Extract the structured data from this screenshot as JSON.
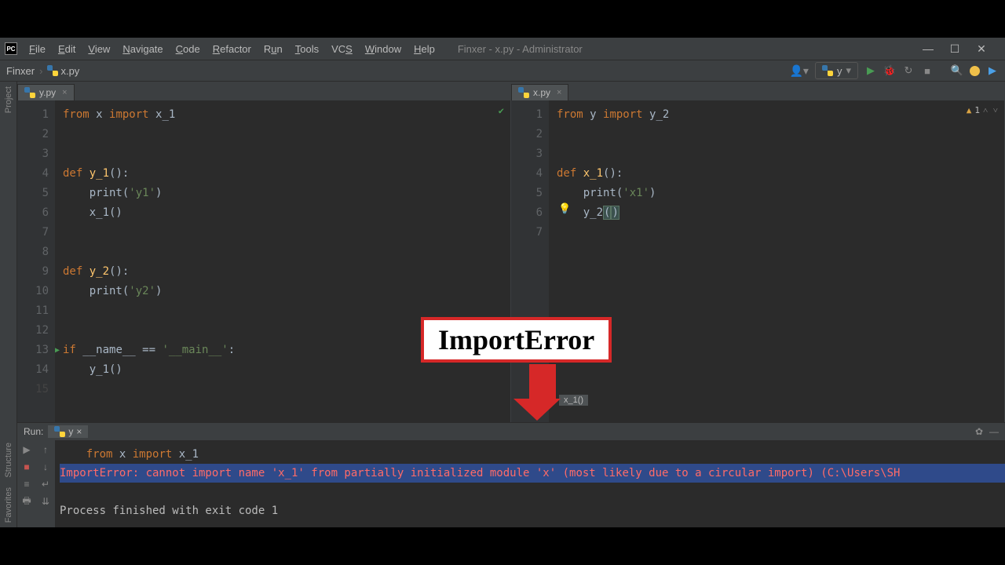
{
  "window": {
    "title": "Finxer - x.py - Administrator"
  },
  "menu": {
    "file": "File",
    "edit": "Edit",
    "view": "View",
    "navigate": "Navigate",
    "code": "Code",
    "refactor": "Refactor",
    "run": "Run",
    "tools": "Tools",
    "vcs": "VCS",
    "window": "Window",
    "help": "Help"
  },
  "breadcrumb": {
    "project": "Finxer",
    "file": "x.py"
  },
  "runconfig": {
    "name": "y"
  },
  "sidebar": {
    "project": "Project",
    "structure": "Structure",
    "favorites": "Favorites"
  },
  "editors": {
    "left": {
      "tab": "y.py",
      "lines": [
        "1",
        "2",
        "3",
        "4",
        "5",
        "6",
        "7",
        "8",
        "9",
        "10",
        "11",
        "12",
        "13",
        "14",
        "15"
      ]
    },
    "right": {
      "tab": "x.py",
      "lines": [
        "1",
        "2",
        "3",
        "4",
        "5",
        "6",
        "7"
      ],
      "warn": "1"
    }
  },
  "code_left": {
    "l1_kw1": "from",
    "l1_mod": " x ",
    "l1_kw2": "import",
    "l1_name": " x_1",
    "l4_kw": "def ",
    "l4_fn": "y_1",
    "l4_rest": "():",
    "l5_pre": "    print(",
    "l5_str": "'y1'",
    "l5_post": ")",
    "l6": "    x_1()",
    "l9_kw": "def ",
    "l9_fn": "y_2",
    "l9_rest": "():",
    "l10_pre": "    print(",
    "l10_str": "'y2'",
    "l10_post": ")",
    "l13_kw": "if ",
    "l13_name": "__name__ == ",
    "l13_str": "'__main__'",
    "l13_post": ":",
    "l14": "    y_1()"
  },
  "code_right": {
    "l1_kw1": "from",
    "l1_mod": " y ",
    "l1_kw2": "import",
    "l1_name": " y_2",
    "l4_kw": "def ",
    "l4_fn": "x_1",
    "l4_rest": "():",
    "l5_pre": "    print(",
    "l5_str": "'x1'",
    "l5_post": ")",
    "l6_pre": "    y_2",
    "l6_p1": "(",
    "l6_p2": ")"
  },
  "overlay": {
    "title": "ImportError"
  },
  "tooltip": {
    "text": "x_1()"
  },
  "run": {
    "label": "Run:",
    "tab": "y",
    "console_import_pre": "    ",
    "console_kw1": "from",
    "console_mid": " x ",
    "console_kw2": "import",
    "console_end": " x_1",
    "error": "ImportError: cannot import name 'x_1' from partially initialized module 'x' (most likely due to a circular import) (C:\\Users\\SH",
    "exit": "Process finished with exit code 1"
  }
}
